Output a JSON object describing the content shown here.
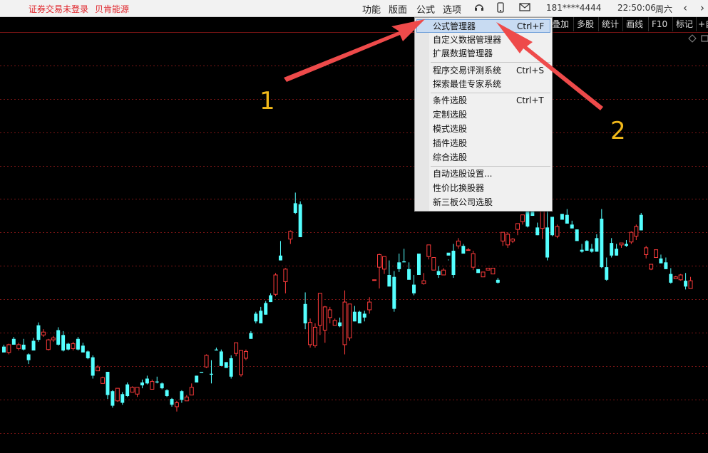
{
  "topbar": {
    "login_status": "证券交易未登录",
    "broker_name": "贝肯能源",
    "menus": [
      "功能",
      "版面",
      "公式",
      "选项"
    ],
    "account": "181****4444",
    "clock": "22:50:06",
    "weekday": "周六"
  },
  "toolbar2": {
    "buttons": [
      "叠加",
      "多股",
      "统计",
      "画线",
      "F10",
      "标记",
      "+自"
    ]
  },
  "dropdown": {
    "items": [
      {
        "label": "公式管理器",
        "shortcut": "Ctrl+F"
      },
      {
        "label": "自定义数据管理器",
        "shortcut": ""
      },
      {
        "label": "扩展数据管理器",
        "shortcut": ""
      },
      {
        "label": "程序交易评测系统",
        "shortcut": "Ctrl+S"
      },
      {
        "label": "探索最佳专家系统",
        "shortcut": ""
      },
      {
        "label": "条件选股",
        "shortcut": "Ctrl+T"
      },
      {
        "label": "定制选股",
        "shortcut": ""
      },
      {
        "label": "模式选股",
        "shortcut": ""
      },
      {
        "label": "插件选股",
        "shortcut": ""
      },
      {
        "label": "综合选股",
        "shortcut": ""
      },
      {
        "label": "自动选股设置...",
        "shortcut": ""
      },
      {
        "label": "性价比换股器",
        "shortcut": ""
      },
      {
        "label": "新三板公司选股",
        "shortcut": ""
      }
    ],
    "selected_index": 0
  },
  "annotations": {
    "label_1": "1",
    "label_2": "2",
    "color": "#f1b81a",
    "arrow_color": "#ee4a4a"
  },
  "colors": {
    "up": "#ff3b3b",
    "down": "#54ffff",
    "grid": "#7a1515",
    "background": "#000000"
  },
  "chart_data": {
    "type": "candlestick",
    "grid": true,
    "candles": [
      [
        16,
        10,
        10,
        18
      ],
      [
        10,
        18,
        19,
        8
      ],
      [
        24,
        18,
        18,
        26
      ],
      [
        14,
        18,
        20,
        12
      ],
      [
        18,
        13,
        12,
        24
      ],
      [
        8,
        2,
        -2,
        9
      ],
      [
        22,
        12,
        12,
        25
      ],
      [
        38,
        23,
        21,
        41
      ],
      [
        28,
        31,
        34,
        26
      ],
      [
        13,
        23,
        24,
        12
      ],
      [
        23,
        25,
        27,
        21
      ],
      [
        33,
        18,
        17,
        36
      ],
      [
        28,
        12,
        11,
        32
      ],
      [
        19,
        13,
        12,
        20
      ],
      [
        14,
        19,
        21,
        12
      ],
      [
        24,
        13,
        12,
        26
      ],
      [
        17,
        10,
        10,
        20
      ],
      [
        11,
        4,
        3,
        12
      ],
      [
        5,
        -14,
        -17,
        7
      ],
      [
        -9,
        -5,
        -3,
        -9
      ],
      [
        -22,
        -16,
        -15,
        -22
      ],
      [
        -10,
        -34,
        -38,
        -11
      ],
      [
        -30,
        -45,
        -47,
        -29
      ],
      [
        -40,
        -27,
        -27,
        -41
      ],
      [
        -33,
        -42,
        -44,
        -31
      ],
      [
        -23,
        -35,
        -36,
        -21
      ],
      [
        -31,
        -26,
        -25,
        -31
      ],
      [
        -33,
        -26,
        -26,
        -36
      ],
      [
        -21,
        -24,
        -27,
        -18
      ],
      [
        -17,
        -22,
        -23,
        -14
      ],
      [
        -28,
        -20,
        -18,
        -28
      ],
      [
        -20,
        -21,
        -15,
        -22
      ],
      [
        -22,
        -27,
        -28,
        -21
      ],
      [
        -29,
        -35,
        -36,
        -28
      ],
      [
        -38,
        -44,
        -46,
        -37
      ],
      [
        -46,
        -42,
        -40,
        -51
      ],
      [
        -30,
        -39,
        -42,
        -29
      ],
      [
        -40,
        -36,
        -34,
        -40
      ],
      [
        -34,
        -26,
        -22,
        -34
      ],
      [
        -14,
        -21,
        -21,
        -14
      ],
      [
        -10,
        -11,
        -9,
        -9
      ],
      [
        -5,
        7,
        8,
        -6
      ],
      [
        -12,
        -13,
        2,
        -22
      ],
      [
        13,
        12,
        15,
        12
      ],
      [
        11,
        -4,
        -4,
        13
      ],
      [
        0,
        -6,
        -6,
        0
      ],
      [
        4,
        -15,
        -17,
        7
      ],
      [
        9,
        20,
        20,
        6
      ],
      [
        -13,
        12,
        12,
        -15
      ],
      [
        4,
        11,
        13,
        2
      ],
      [
        30,
        24,
        24,
        32
      ],
      [
        50,
        42,
        40,
        52
      ],
      [
        53,
        40,
        40,
        57
      ],
      [
        61,
        49,
        49,
        63
      ],
      [
        69,
        62,
        62,
        71
      ],
      [
        70,
        90,
        92,
        68
      ],
      [
        110,
        105,
        105,
        125
      ],
      [
        83,
        96,
        97,
        71
      ],
      [
        127,
        135,
        136,
        122
      ],
      [
        164,
        154,
        153,
        175
      ],
      [
        163,
        129,
        129,
        166
      ],
      [
        60,
        40,
        34,
        72
      ],
      [
        18,
        41,
        45,
        15
      ],
      [
        17,
        36,
        40,
        15
      ],
      [
        38,
        71,
        71,
        28
      ],
      [
        33,
        57,
        58,
        20
      ],
      [
        46,
        54,
        57,
        40
      ],
      [
        38,
        43,
        45,
        40
      ],
      [
        41,
        37,
        36,
        46
      ],
      [
        18,
        62,
        74,
        8
      ],
      [
        25,
        60,
        60,
        22
      ],
      [
        52,
        42,
        42,
        58
      ],
      [
        52,
        40,
        40,
        53
      ],
      [
        50,
        46,
        42,
        53
      ],
      [
        54,
        62,
        67,
        50
      ],
      [
        85,
        85,
        88,
        88
      ],
      [
        98,
        111,
        112,
        76
      ],
      [
        96,
        109,
        109,
        91
      ],
      [
        90,
        78,
        80,
        105
      ],
      [
        88,
        55,
        52,
        94
      ],
      [
        103,
        96,
        93,
        112
      ],
      [
        104,
        103,
        103,
        117
      ],
      [
        96,
        85,
        88,
        103
      ],
      [
        80,
        71,
        69,
        90
      ],
      [
        112,
        90,
        90,
        110
      ],
      [
        81,
        84,
        80,
        92
      ],
      [
        109,
        121,
        121,
        106
      ],
      [
        95,
        108,
        106,
        102
      ],
      [
        94,
        90,
        87,
        99
      ],
      [
        90,
        95,
        93,
        97
      ],
      [
        113,
        110,
        105,
        106
      ],
      [
        115,
        90,
        87,
        122
      ],
      [
        120,
        125,
        128,
        117
      ],
      [
        120,
        112,
        113,
        122
      ],
      [
        116,
        116,
        116,
        118
      ],
      [
        98,
        112,
        115,
        95
      ],
      [
        96,
        92,
        95,
        95
      ],
      [
        88,
        93,
        90,
        92
      ],
      [
        95,
        97,
        96,
        97
      ],
      [
        91,
        97,
        94,
        91
      ],
      [
        85,
        82,
        81,
        87
      ],
      [
        125,
        134,
        134,
        120
      ],
      [
        121,
        132,
        134,
        118
      ],
      [
        125,
        127,
        128,
        123
      ],
      [
        137,
        143,
        143,
        131
      ],
      [
        145,
        152,
        152,
        142
      ],
      [
        158,
        140,
        139,
        163
      ],
      [
        156,
        151,
        151,
        157
      ],
      [
        139,
        131,
        131,
        144
      ],
      [
        138,
        160,
        168,
        127
      ],
      [
        139,
        108,
        105,
        156
      ],
      [
        150,
        131,
        130,
        148
      ],
      [
        130,
        140,
        142,
        128
      ],
      [
        153,
        147,
        147,
        153
      ],
      [
        152,
        143,
        143,
        158
      ],
      [
        142,
        138,
        138,
        146
      ],
      [
        137,
        125,
        126,
        137
      ],
      [
        116,
        114,
        113,
        122
      ],
      [
        125,
        115,
        115,
        126
      ],
      [
        117,
        114,
        113,
        122
      ],
      [
        128,
        114,
        114,
        132
      ],
      [
        148,
        98,
        97,
        158
      ],
      [
        98,
        85,
        84,
        108
      ],
      [
        123,
        110,
        108,
        128
      ],
      [
        117,
        110,
        110,
        122
      ],
      [
        121,
        123,
        123,
        118
      ],
      [
        122,
        120,
        119,
        126
      ],
      [
        124,
        134,
        135,
        122
      ],
      [
        130,
        140,
        142,
        126
      ],
      [
        152,
        136,
        136,
        154
      ],
      [
        111,
        118,
        120,
        107
      ],
      [
        96,
        101,
        99,
        95
      ],
      [
        108,
        116,
        114,
        108
      ],
      [
        107,
        102,
        102,
        111
      ],
      [
        103,
        96,
        96,
        108
      ],
      [
        91,
        82,
        81,
        97
      ],
      [
        86,
        88,
        89,
        88
      ],
      [
        85,
        90,
        91,
        84
      ],
      [
        84,
        78,
        75,
        92
      ],
      [
        76,
        84,
        88,
        79
      ]
    ]
  }
}
